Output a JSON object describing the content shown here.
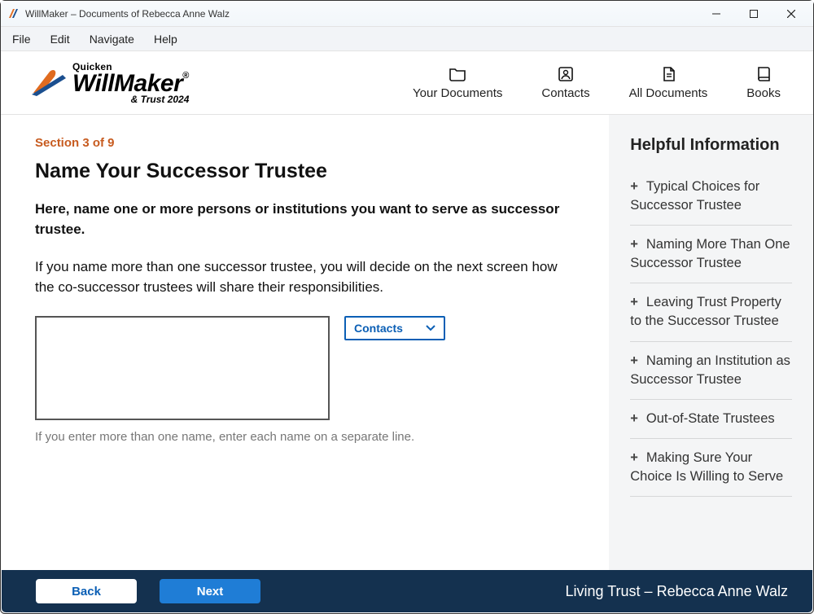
{
  "window": {
    "title": "WillMaker – Documents of Rebecca Anne Walz"
  },
  "menu": {
    "file": "File",
    "edit": "Edit",
    "navigate": "Navigate",
    "help": "Help"
  },
  "logo": {
    "brand": "Quicken",
    "product": "WillMaker",
    "suffix": "& Trust 2024"
  },
  "header_nav": {
    "your_documents": "Your Documents",
    "contacts": "Contacts",
    "all_documents": "All Documents",
    "books": "Books"
  },
  "main": {
    "section_label": "Section 3 of 9",
    "title": "Name Your Successor Trustee",
    "bold_para": "Here, name one or more persons or institutions you want to serve as successor trustee.",
    "normal_para": "If you name more than one successor trustee, you will decide on the next screen how the co-successor trustees will share their responsibilities.",
    "textarea_value": "",
    "contacts_button": "Contacts",
    "hint": "If you enter more than one name, enter each name on a separate line."
  },
  "help": {
    "title": "Helpful Information",
    "items": [
      "Typical Choices for Successor Trustee",
      "Naming More Than One Successor Trustee",
      "Leaving Trust Property to the Successor Trustee",
      "Naming an Institution as Successor Trustee",
      "Out-of-State Trustees",
      "Making Sure Your Choice Is Willing to Serve"
    ]
  },
  "footer": {
    "back": "Back",
    "next": "Next",
    "doc_title": "Living Trust – Rebecca Anne Walz"
  }
}
